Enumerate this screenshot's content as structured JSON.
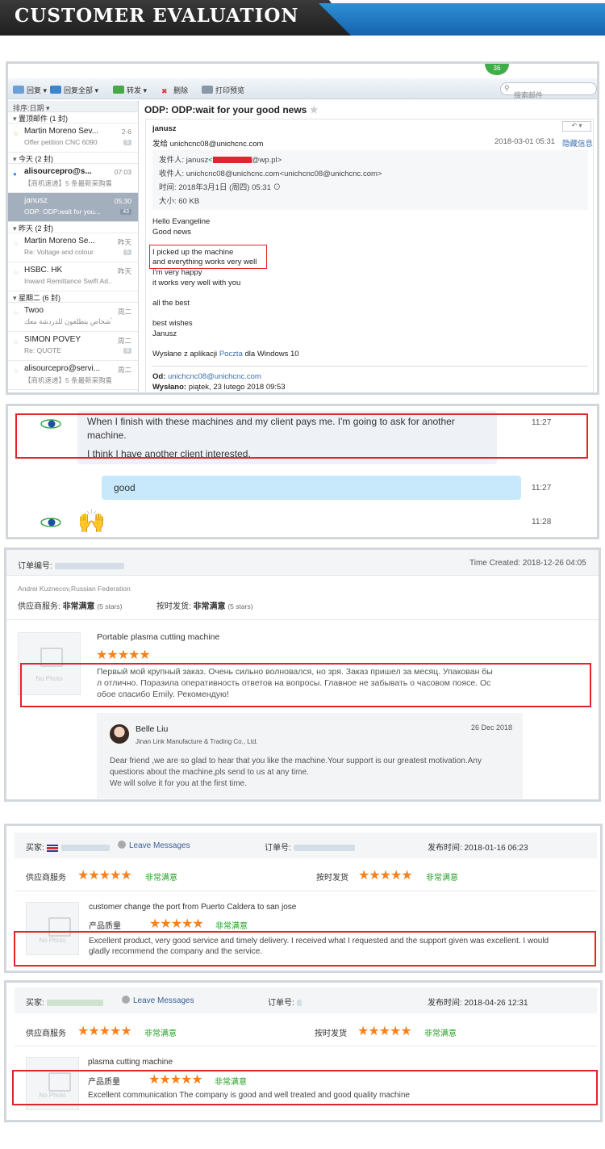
{
  "banner": {
    "title": "CUSTOMER EVALUATION"
  },
  "email": {
    "toolbar": {
      "reply": "回复",
      "reply_all": "回复全部",
      "forward": "转发",
      "delete": "删除",
      "print": "打印预览",
      "search_placeholder": "搜索邮件",
      "badge": "36"
    },
    "list": {
      "sort": "排序:日期",
      "groups": [
        {
          "label": "置顶邮件 (1 封)",
          "items": [
            {
              "sender": "Martin Moreno Sev...",
              "preview": "Offer petition CNC 6090",
              "time": "2-6",
              "count": "6"
            }
          ]
        },
        {
          "label": "今天 (2 封)",
          "items": [
            {
              "sender": "alisourcepro@s...",
              "preview": "【商机速递】5 条最新采购需...",
              "time": "07:03",
              "count": ""
            },
            {
              "sender": "janusz",
              "preview": "ODP: ODP:wait for you...",
              "time": "05:30",
              "count": "43"
            }
          ]
        },
        {
          "label": "昨天 (2 封)",
          "items": [
            {
              "sender": "Martin Moreno Se...",
              "preview": "Re: Voltage and colour",
              "time": "昨天",
              "count": "6"
            },
            {
              "sender": "HSBC. HK",
              "preview": "Inward Remittance Swift Ad...",
              "time": "昨天",
              "count": ""
            }
          ]
        },
        {
          "label": "星期二 (6 封)",
          "items": [
            {
              "sender": "Twoo",
              "preview": "اهلاً، الأشخاص يتطلعون للدردشة معك",
              "time": "周二",
              "count": ""
            },
            {
              "sender": "SIMON POVEY",
              "preview": "Re: QUOTE",
              "time": "周二",
              "count": "8"
            },
            {
              "sender": "alisourcepro@servi...",
              "preview": "【商机速递】5 条最新采购需...",
              "time": "周二",
              "count": ""
            }
          ]
        }
      ]
    },
    "reader": {
      "subject": "ODP: ODP:wait for your good news",
      "from_name": "janusz",
      "sent_to": "发给 unichcnc08@unichcnc.com",
      "date": "2018-03-01 05:31",
      "hide_info": "隐藏信息",
      "sender_line_prefix": "发件人: janusz<",
      "sender_line_suffix": "@wp.pl>",
      "recipient_line": "收件人: unichcnc08@unichcnc.com<unichcnc08@unichcnc.com>",
      "time_line": "时间: 2018年3月1日 (周四) 05:31",
      "size_line": "大小: 60 KB",
      "body": [
        "Hello Evangeline",
        "Good news",
        "I picked up the machine",
        "and everything works very well",
        "I'm very happy",
        "it works very well with you",
        "all the best",
        "best wishes",
        "Janusz",
        "Wysłane z aplikacji",
        "Poczta",
        "dla Windows 10"
      ],
      "od_label": "Od:",
      "od_value": "unichcnc08@unichcnc.com",
      "wyslano_label": "Wysłano:",
      "wyslano_value": "piątek, 23 lutego 2018 09:53"
    }
  },
  "chat": {
    "msg1_line1": "When I finish with these machines and my client pays me. I'm going to ask for another",
    "msg1_line2": "machine.",
    "msg1_line3": "I think I have another client interested.",
    "msg1_time": "11:27",
    "msg2": "good",
    "msg2_time": "11:27",
    "msg3_time": "11:28"
  },
  "review1": {
    "order_label": "订单编号:",
    "time_created": "Time Created: 2018-12-26 04:05",
    "buyer": "Andrei Kuznecov,Russian Federation",
    "supplier_service_label": "供应商服务:",
    "supplier_service_value": "非常满意",
    "supplier_stars": "(5 stars)",
    "delivery_label": "按时发货:",
    "delivery_value": "非常满意",
    "delivery_stars": "(5 stars)",
    "no_photo": "No Photo",
    "product": "Portable plasma cutting machine",
    "comment_1": "Первый мой крупный заказ. Очень сильно волновался, но зря. Заказ пришел за месяц. Упакован бы",
    "comment_2": "л отлично. Поразила оперативность ответов на вопросы. Главное не забывать о часовом поясе. Ос",
    "comment_3": "обое спасибо Emily. Рекомендую!",
    "reply_name": "Belle Liu",
    "reply_company": "Jinan Link Manufacture & Trading Co., Ltd.",
    "reply_date": "26 Dec 2018",
    "reply_1": "Dear friend ,we are so glad to hear that you like the machine.Your support is our greatest motivation.Any",
    "reply_2": "questions about the machine,pls send to us at any time.",
    "reply_3": "We will solve it for you at the first time."
  },
  "review2": {
    "buyer_label": "买家:",
    "leave_messages": "Leave Messages",
    "order_label": "订单号:",
    "publish_time": "发布时间: 2018-01-16 06:23",
    "supplier_service_label": "供应商服务",
    "supplier_service_value": "非常满意",
    "delivery_label": "按时发货",
    "delivery_value": "非常满意",
    "no_photo": "No Photo",
    "note": "customer change the port from Puerto Caldera to san jose",
    "quality_label": "产品质量",
    "quality_value": "非常满意",
    "comment_1": "Excellent product, very good service and timely delivery. I received what I requested and the support given was excellent. I would",
    "comment_2": "gladly recommend the company and the service."
  },
  "review3": {
    "buyer_label": "买家:",
    "leave_messages": "Leave Messages",
    "order_label": "订单号:",
    "publish_time": "发布时间: 2018-04-26 12:31",
    "supplier_service_label": "供应商服务",
    "supplier_service_value": "非常满意",
    "delivery_label": "按时发货",
    "delivery_value": "非常满意",
    "no_photo": "No Photo",
    "product": "plasma cutting machine",
    "quality_label": "产品质量",
    "quality_value": "非常满意",
    "comment": "Excellent communication The company is good and well treated and good quality machine"
  },
  "rating": {
    "stars": "★★★★★",
    "stars_count": 5
  },
  "colors": {
    "highlight_border": "#e0252b",
    "star": "#f5821f",
    "satisfied": "#27a027",
    "banner_blue": "#1f74bf"
  }
}
